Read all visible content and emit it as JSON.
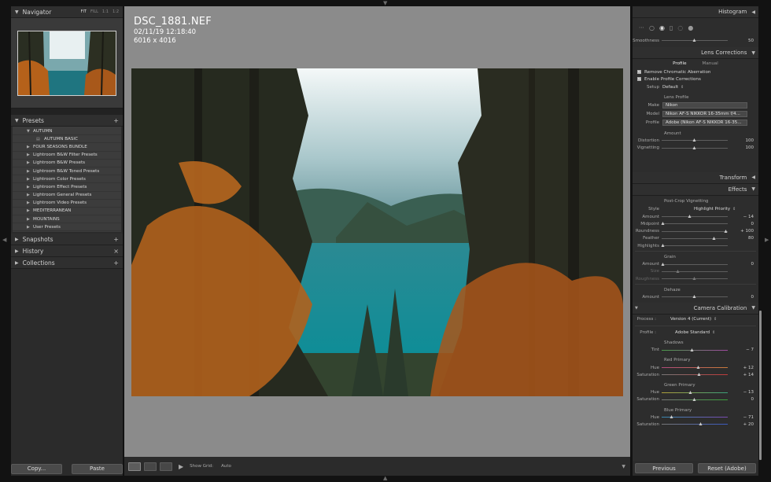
{
  "navigator": {
    "title": "Navigator",
    "options": [
      "FIT",
      "FILL",
      "1:1",
      "1:2"
    ]
  },
  "presets": {
    "title": "Presets",
    "add_symbol": "+",
    "items": [
      {
        "label": "AUTUMN",
        "open": true
      },
      {
        "label": "AUTUMN BASIC",
        "sub": true
      },
      {
        "label": "FOUR SEASONS BUNDLE"
      },
      {
        "label": "Lightroom B&W Filter Presets"
      },
      {
        "label": "Lightroom B&W Presets"
      },
      {
        "label": "Lightroom B&W Toned Presets"
      },
      {
        "label": "Lightroom Color Presets"
      },
      {
        "label": "Lightroom Effect Presets"
      },
      {
        "label": "Lightroom General Presets"
      },
      {
        "label": "Lightroom Video Presets"
      },
      {
        "label": "MEDITERRANEAN"
      },
      {
        "label": "MOUNTAINS"
      },
      {
        "label": "User Presets"
      }
    ]
  },
  "snapshots": {
    "title": "Snapshots",
    "symbol": "+"
  },
  "history": {
    "title": "History",
    "symbol": "×"
  },
  "collections": {
    "title": "Collections",
    "symbol": "+"
  },
  "left_buttons": {
    "copy": "Copy...",
    "paste": "Paste"
  },
  "photo_info": {
    "filename": "DSC_1881.NEF",
    "datetime": "02/11/19 12:18:40",
    "dimensions": "6016 x 4016"
  },
  "toolbar": {
    "show_grid_label": "Show Grid:",
    "show_grid_value": "Auto"
  },
  "histogram": {
    "title": "Histogram"
  },
  "smoothness": {
    "label": "Smoothness",
    "value": "50",
    "level": 0.5
  },
  "lens_corrections": {
    "title": "Lens Corrections",
    "tabs": [
      "Profile",
      "Manual"
    ],
    "remove_ca": "Remove Chromatic Aberration",
    "enable_profile": "Enable Profile Corrections",
    "setup_label": "Setup",
    "setup_value": "Default",
    "lens_profile_title": "Lens Profile",
    "make_label": "Make",
    "make_value": "Nikon",
    "model_label": "Model",
    "model_value": "Nikon AF-S NIKKOR 16-35mm f/4...",
    "profile_label": "Profile",
    "profile_value": "Adobe (Nikon AF-S NIKKOR 16-35...",
    "amount_title": "Amount",
    "distortion": {
      "label": "Distortion",
      "value": "100",
      "level": 0.5
    },
    "vignetting": {
      "label": "Vignetting",
      "value": "100",
      "level": 0.5
    }
  },
  "transform": {
    "title": "Transform"
  },
  "effects": {
    "title": "Effects",
    "pcv_title": "Post-Crop Vignetting",
    "style_label": "Style",
    "style_value": "Highlight Priority",
    "sliders": [
      {
        "label": "Amount",
        "value": "− 14",
        "level": 0.43
      },
      {
        "label": "Midpoint",
        "value": "0",
        "level": 0.02
      },
      {
        "label": "Roundness",
        "value": "+ 100",
        "level": 0.98
      },
      {
        "label": "Feather",
        "value": "80",
        "level": 0.8
      },
      {
        "label": "Highlights",
        "value": "",
        "level": 0.02
      }
    ],
    "grain_title": "Grain",
    "grain": [
      {
        "label": "Amount",
        "value": "0",
        "level": 0.02,
        "dim": false
      },
      {
        "label": "Size",
        "value": "",
        "level": 0.25,
        "dim": true
      },
      {
        "label": "Roughness",
        "value": "",
        "level": 0.5,
        "dim": true
      }
    ],
    "dehaze_title": "Dehaze",
    "dehaze": {
      "label": "Amount",
      "value": "0",
      "level": 0.5
    }
  },
  "camera_calibration": {
    "title": "Camera Calibration",
    "process_label": "Process :",
    "process_value": "Version 4 (Current)",
    "profile_label": "Profile :",
    "profile_value": "Adobe Standard",
    "shadows_title": "Shadows",
    "shadows_tint": {
      "label": "Tint",
      "value": "− 7",
      "level": 0.46
    },
    "red_title": "Red Primary",
    "red": [
      {
        "label": "Hue",
        "value": "+ 12",
        "level": 0.56
      },
      {
        "label": "Saturation",
        "value": "+ 14",
        "level": 0.57
      }
    ],
    "green_title": "Green Primary",
    "green": [
      {
        "label": "Hue",
        "value": "− 13",
        "level": 0.44
      },
      {
        "label": "Saturation",
        "value": "0",
        "level": 0.5
      }
    ],
    "blue_title": "Blue Primary",
    "blue": [
      {
        "label": "Hue",
        "value": "− 71",
        "level": 0.15
      },
      {
        "label": "Saturation",
        "value": "+ 20",
        "level": 0.6
      }
    ]
  },
  "right_buttons": {
    "previous": "Previous",
    "reset": "Reset (Adobe)"
  }
}
